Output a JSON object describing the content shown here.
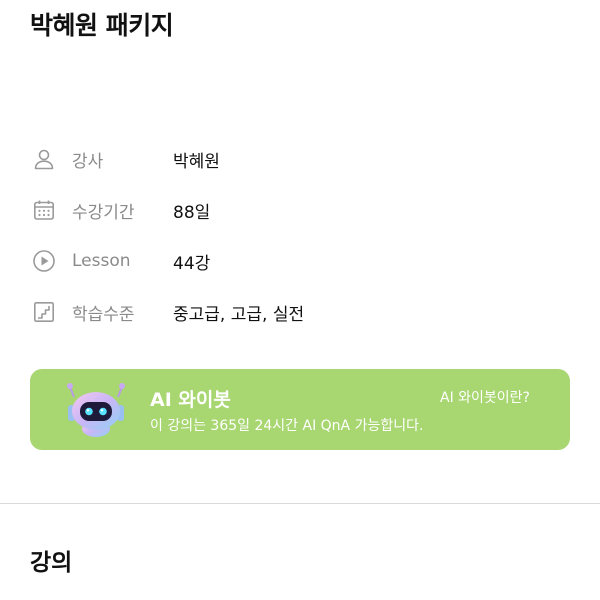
{
  "package": {
    "title": "박혜원 패키지"
  },
  "info": {
    "instructor": {
      "label": "강사",
      "value": "박혜원",
      "icon": "person-icon"
    },
    "period": {
      "label": "수강기간",
      "value": "88일",
      "icon": "calendar-icon"
    },
    "lessons": {
      "label": "Lesson",
      "value": "44강",
      "icon": "play-circle-icon"
    },
    "level": {
      "label": "학습수준",
      "value": "중고급, 고급, 실전",
      "icon": "stairs-icon"
    }
  },
  "ai_bot": {
    "title": "AI 와이봇",
    "description": "이 강의는 365일 24시간 AI QnA 가능합니다.",
    "link_label": "AI 와이봇이란?",
    "card_color": "#a8d671",
    "icon": "robot-icon"
  },
  "section": {
    "title": "강의"
  }
}
